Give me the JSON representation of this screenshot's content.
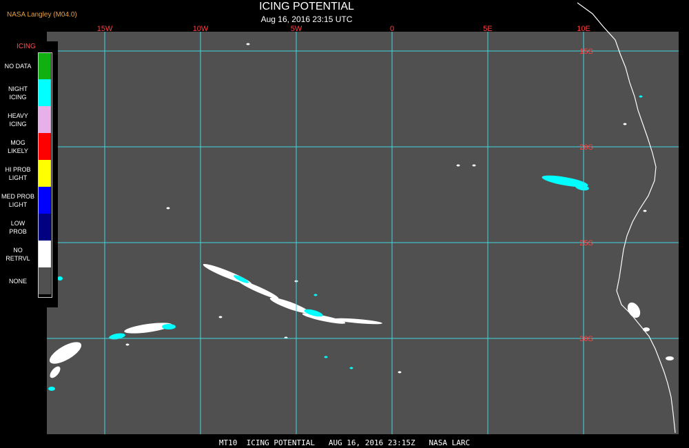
{
  "header": {
    "credit": "NASA Langley (M04.0)",
    "title": "ICING POTENTIAL",
    "subtitle": "Aug 16, 2016 23:15 UTC"
  },
  "legend": {
    "title": "ICING",
    "items": [
      {
        "label": [
          "NO DATA"
        ],
        "color": "#10b010"
      },
      {
        "label": [
          "NIGHT",
          "ICING"
        ],
        "color": "#00ffff"
      },
      {
        "label": [
          "HEAVY",
          "ICING"
        ],
        "color": "#e8b0e8"
      },
      {
        "label": [
          "MOG",
          "LIKELY"
        ],
        "color": "#ff0000"
      },
      {
        "label": [
          "HI PROB",
          "LIGHT"
        ],
        "color": "#ffff00"
      },
      {
        "label": [
          "MED PROB",
          "LIGHT"
        ],
        "color": "#0000ff"
      },
      {
        "label": [
          "LOW",
          "PROB"
        ],
        "color": "#000080"
      },
      {
        "label": [
          "NO",
          "RETRVL"
        ],
        "color": "#ffffff"
      },
      {
        "label": [
          "NONE"
        ],
        "color": "#505050"
      }
    ]
  },
  "grid": {
    "longitude_labels": [
      "15W",
      "10W",
      "5W",
      "0",
      "5E",
      "10E"
    ],
    "latitude_labels": [
      "15S",
      "20S",
      "25S",
      "30S"
    ],
    "grid_color": "#40d8e0",
    "label_color": "#ff4040"
  },
  "map": {
    "background_color": "#505050",
    "coastline_color": "#ffffff",
    "cloud_colors": [
      "#00ffff",
      "#ffffff"
    ]
  },
  "footer": {
    "text": "MT10  ICING POTENTIAL   AUG 16, 2016 23:15Z   NASA LARC"
  }
}
